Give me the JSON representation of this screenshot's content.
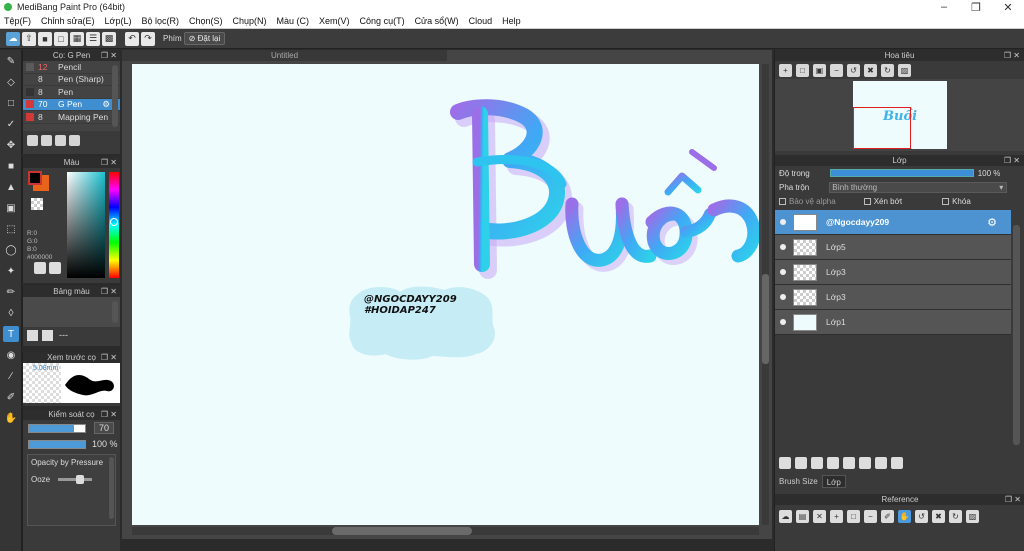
{
  "window": {
    "title": "MediBang Paint Pro (64bit)"
  },
  "menu": [
    "Tệp(F)",
    "Chỉnh sửa(E)",
    "Lớp(L)",
    "Bộ lọc(R)",
    "Chọn(S)",
    "Chụp(N)",
    "Màu (C)",
    "Xem(V)",
    "Công cụ(T)",
    "Cửa sổ(W)",
    "Cloud",
    "Help"
  ],
  "toolbar": {
    "key_label": "Phím",
    "reset_label": "Đặt lại"
  },
  "brush_panel": {
    "title": "Cọ: G Pen",
    "items": [
      {
        "size": "12",
        "name": "Pencil",
        "color": "#5a5a5a"
      },
      {
        "size": "8",
        "name": "Pen (Sharp)",
        "color": "#444444"
      },
      {
        "size": "8",
        "name": "Pen",
        "color": "#333333"
      },
      {
        "size": "70",
        "name": "G Pen",
        "color": "#d23a3a"
      },
      {
        "size": "8",
        "name": "Mapping Pen",
        "color": "#d23a3a"
      }
    ]
  },
  "color_panel": {
    "title": "Màu",
    "r": "R:0",
    "g": "G:0",
    "b": "B:0",
    "hex": "#000000",
    "fg": "#000000",
    "bg": "#e8641b"
  },
  "palette_panel": {
    "title": "Bảng màu",
    "dash": "---"
  },
  "preview_panel": {
    "title": "Xem trước cọ",
    "size": "5.08mm"
  },
  "brush_control": {
    "title": "Kiểm soát cọ",
    "size_value": "70",
    "opacity_value": "100 %",
    "opacity_pressure": "Opacity by Pressure",
    "ooze": "Ooze"
  },
  "canvas": {
    "tab": "Untitled",
    "watermark_1": "@NGOCDAYY209",
    "watermark_2": "#HOIDAP247",
    "lettering": "Buồi"
  },
  "navigator": {
    "title": "Hoa tiêu",
    "thumb_text": "Buồi"
  },
  "layer_panel": {
    "title": "Lớp",
    "opacity_label": "Độ trong",
    "opacity_value": "100 %",
    "blend_label": "Pha trộn",
    "blend_value": "Bình thường",
    "protect_alpha": "Bảo vệ alpha",
    "clipping": "Xén bớt",
    "lock": "Khóa",
    "layers": [
      {
        "name": "@Ngocdayy209",
        "selected": true
      },
      {
        "name": "Lớp5",
        "selected": false
      },
      {
        "name": "Lớp3",
        "selected": false
      },
      {
        "name": "Lớp3",
        "selected": false
      },
      {
        "name": "Lớp1",
        "selected": false
      }
    ],
    "tab_brush_size": "Brush Size",
    "tab_layer": "Lớp"
  },
  "reference_panel": {
    "title": "Reference"
  }
}
